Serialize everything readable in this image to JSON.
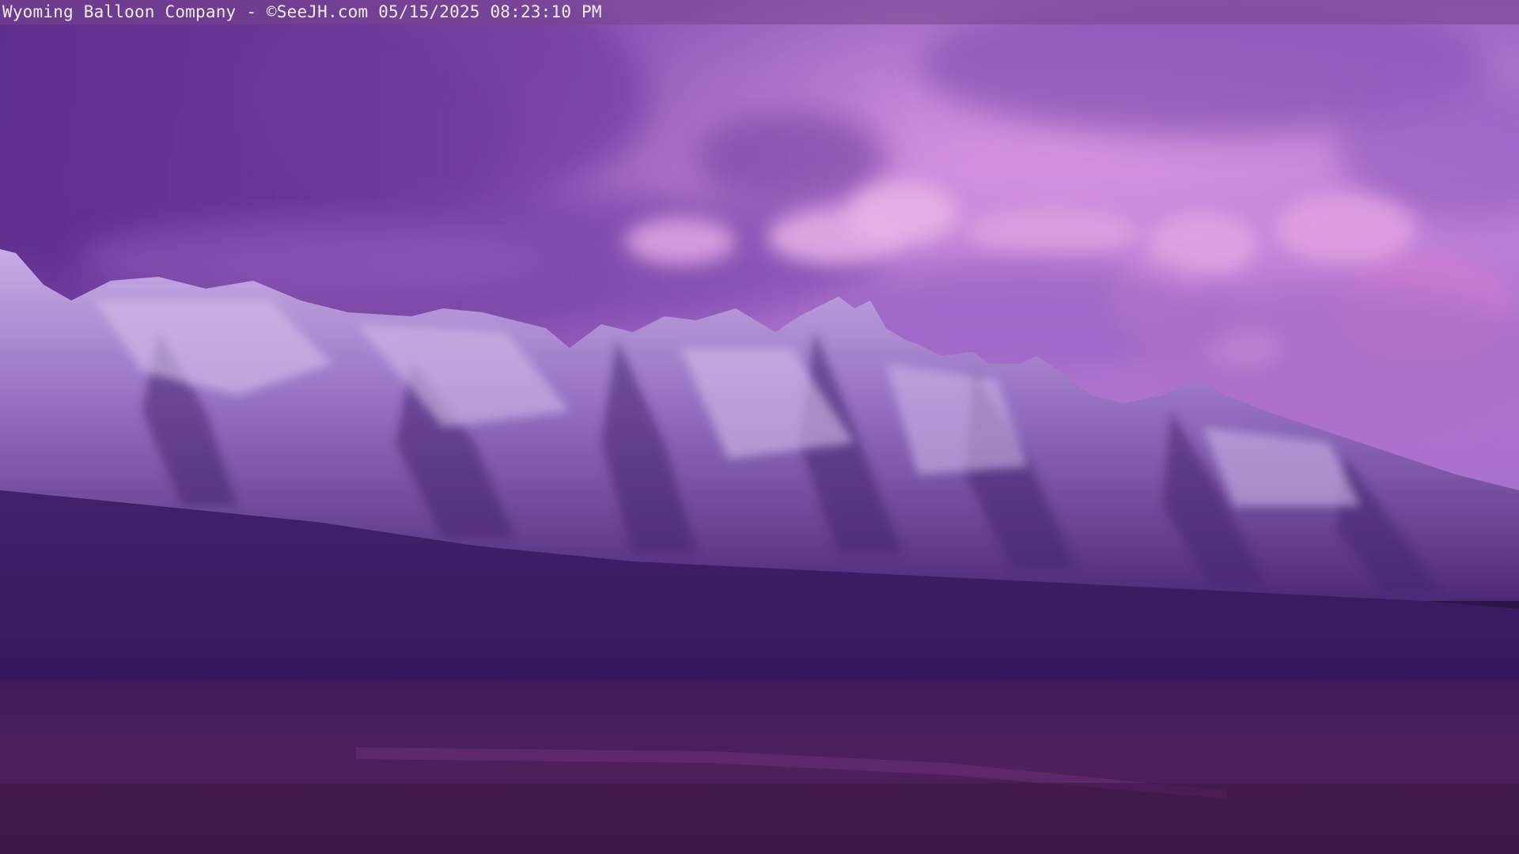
{
  "overlay": {
    "caption": "Wyoming Balloon Company - ©SeeJH.com 05/15/2025 08:23:10 PM"
  },
  "scene": {
    "description_icon": "mountain-landscape",
    "colors": {
      "sky_top": "#b97fd8",
      "sky_mid": "#d79ae6",
      "cloud_pink": "#f0a6ea",
      "cloud_shadow": "#7b4aa6",
      "snow": "#cfb3ec",
      "rock": "#4a2a6a",
      "foothills": "#3a1f5c",
      "valley": "#3d1a4a"
    }
  }
}
